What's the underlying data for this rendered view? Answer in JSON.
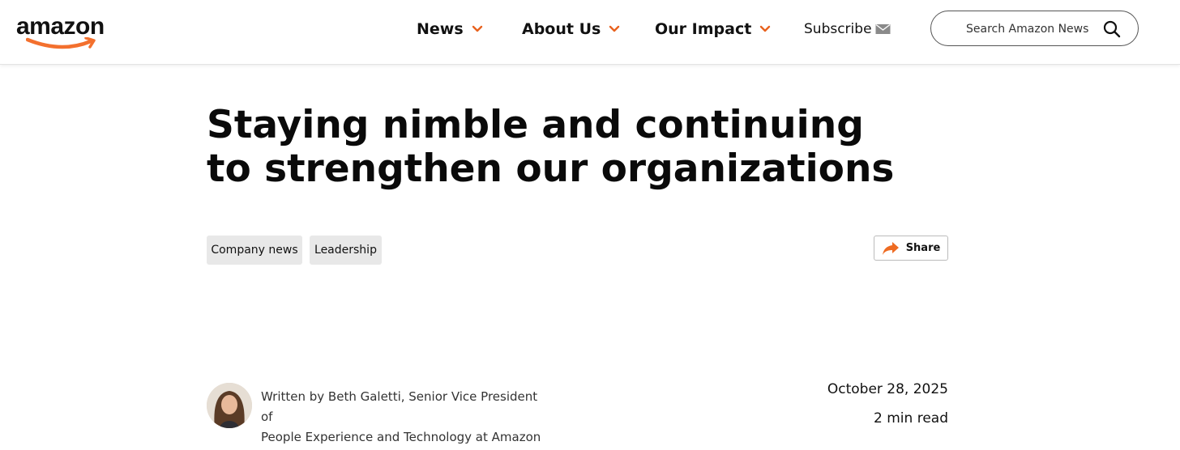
{
  "brand": {
    "logo_text": "amazon",
    "accent_color": "#f3702e"
  },
  "nav": {
    "items": [
      {
        "label": "News"
      },
      {
        "label": "About Us"
      },
      {
        "label": "Our Impact"
      }
    ],
    "subscribe_label": "Subscribe"
  },
  "search": {
    "placeholder": "Search Amazon News"
  },
  "article": {
    "title": "Staying nimble and continuing to strengthen our organizations",
    "tags": [
      "Company news",
      "Leadership"
    ],
    "share_label": "Share",
    "byline_line1": "Written by Beth Galetti, Senior Vice President of",
    "byline_line2": "People Experience and Technology at Amazon",
    "date": "October 28, 2025",
    "read_time": "2 min read"
  }
}
